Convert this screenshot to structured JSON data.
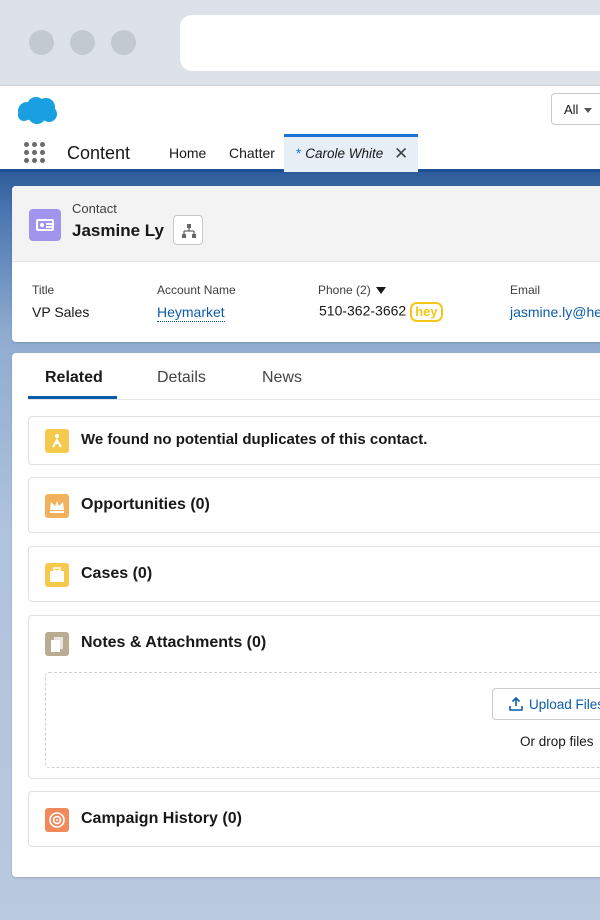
{
  "header": {
    "scope_label": "All"
  },
  "nav": {
    "app_name": "Content",
    "items": [
      "Home",
      "Chatter"
    ],
    "active_tab": {
      "marker": "*",
      "label": "Carole White",
      "close": "✕"
    }
  },
  "record": {
    "object_label": "Contact",
    "name": "Jasmine Ly",
    "fields": {
      "title_label": "Title",
      "title_value": "VP Sales",
      "account_label": "Account Name",
      "account_value": "Heymarket",
      "phone_label": "Phone (2)",
      "phone_value": "510-362-3662",
      "hey_badge": "hey",
      "email_label": "Email",
      "email_value": "jasmine.ly@heymarket.com"
    }
  },
  "tabs": [
    "Related",
    "Details",
    "News"
  ],
  "related": {
    "duplicates": "We found no potential duplicates of this contact.",
    "opportunities": "Opportunities (0)",
    "cases": "Cases (0)",
    "notes": "Notes & Attachments (0)",
    "upload_label": "Upload Files",
    "drop_label": "Or drop files",
    "campaign": "Campaign History (0)"
  },
  "colors": {
    "contact_icon": "#a094ed",
    "duplicates_icon": "#f4c94c",
    "opportunities_icon": "#f2b15c",
    "cases_icon": "#f4c94c",
    "notes_icon": "#baac93",
    "campaign_icon": "#f08a5d",
    "link": "#0b5cab",
    "brand_blue": "#1b5297"
  }
}
